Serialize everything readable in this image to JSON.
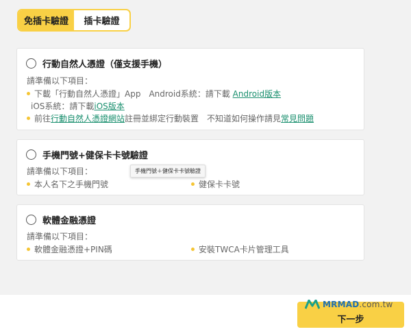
{
  "tabs": [
    {
      "label": "免插卡驗證",
      "active": true
    },
    {
      "label": "插卡驗證",
      "active": false
    }
  ],
  "card1": {
    "title": "行動自然人憑證（僅支援手機）",
    "intro": "請準備以下項目：",
    "bullet1_text": "下載「行動自然人憑證」App　Android系統：請下載",
    "bullet1_link": "Android版本",
    "ios_text": "iOS系統：請下載",
    "ios_link": "iOS版本",
    "bullet2_pre": "前往",
    "bullet2_link": "行動自然人憑證網站",
    "bullet2_mid": "註冊並綁定行動裝置　不知道如何操作請見",
    "bullet2_link2": "常見問題"
  },
  "card2": {
    "title": "手機門號+健保卡卡號驗證",
    "intro": "請準備以下項目：",
    "item_left": "本人名下之手機門號",
    "item_right": "健保卡卡號",
    "tooltip": "手機門號＋健保卡卡號驗證"
  },
  "card3": {
    "title": "軟體金融憑證",
    "intro": "請準備以下項目：",
    "item_left": "軟體金融憑證+PIN碼",
    "item_right": "安裝TWCA卡片管理工具"
  },
  "watermark": {
    "brand": "MRMAD",
    "domain": ".com.tw"
  },
  "next_button": "下一步",
  "colors": {
    "accent": "#f9d045",
    "link": "#198f6e",
    "bullet": "#f5c534"
  }
}
